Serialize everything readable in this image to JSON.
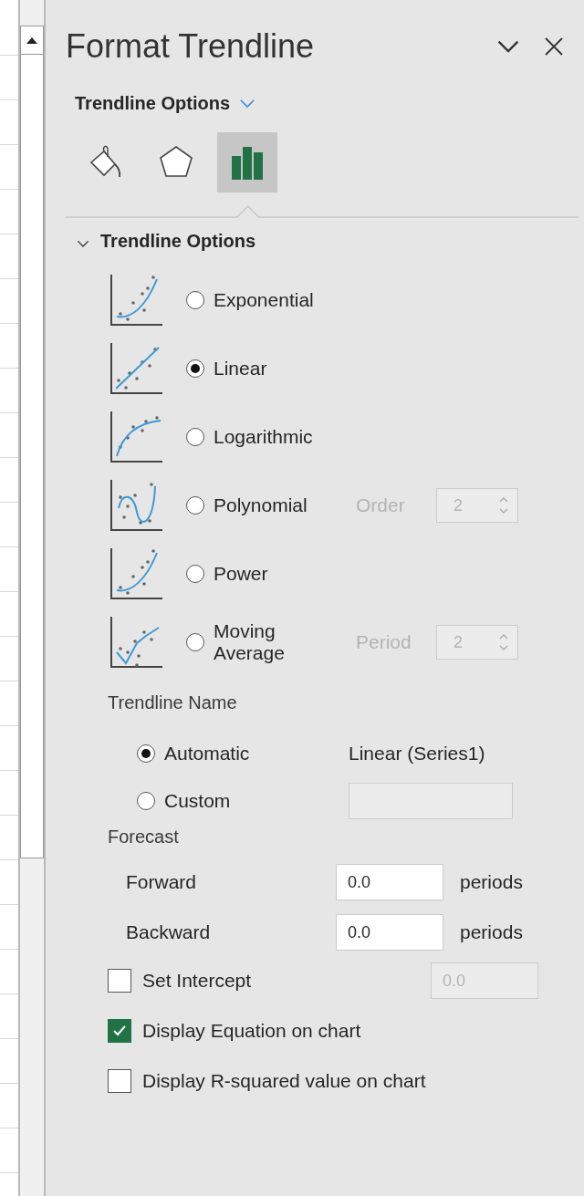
{
  "panel": {
    "title": "Format Trendline"
  },
  "category": {
    "label": "Trendline Options"
  },
  "tabs": [
    {
      "kind": "fill",
      "selected": false
    },
    {
      "kind": "effects",
      "selected": false
    },
    {
      "kind": "options",
      "selected": true
    }
  ],
  "section": {
    "title": "Trendline Options",
    "expanded": true
  },
  "types": [
    {
      "kind": "exponential",
      "label": "Exponential",
      "selected": false
    },
    {
      "kind": "linear",
      "label": "Linear",
      "selected": true
    },
    {
      "kind": "logarithmic",
      "label": "Logarithmic",
      "selected": false
    },
    {
      "kind": "polynomial",
      "label": "Polynomial",
      "selected": false,
      "param": {
        "label": "Order",
        "value": "2",
        "disabled": true
      }
    },
    {
      "kind": "power",
      "label": "Power",
      "selected": false
    },
    {
      "kind": "moving",
      "label": "Moving Average",
      "selected": false,
      "param": {
        "label": "Period",
        "value": "2",
        "disabled": true
      }
    }
  ],
  "trendline_name": {
    "title": "Trendline Name",
    "options": [
      {
        "kind": "automatic",
        "label": "Automatic",
        "selected": true,
        "value": "Linear (Series1)"
      },
      {
        "kind": "custom",
        "label": "Custom",
        "selected": false
      }
    ]
  },
  "forecast": {
    "title": "Forecast",
    "rows": [
      {
        "label": "Forward",
        "value": "0.0",
        "unit": "periods"
      },
      {
        "label": "Backward",
        "value": "0.0",
        "unit": "periods"
      }
    ]
  },
  "checks": [
    {
      "label": "Set Intercept",
      "checked": false,
      "value": "0.0",
      "disabled": true
    },
    {
      "label": "Display Equation on chart",
      "checked": true
    },
    {
      "label": "Display R-squared value on chart",
      "checked": false
    }
  ]
}
